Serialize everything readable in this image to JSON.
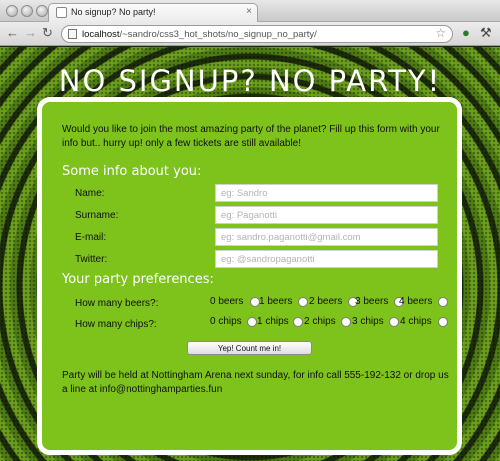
{
  "browser": {
    "tab_title": "No signup? No party!",
    "url_host": "localhost",
    "url_path": "/~sandro/css3_hot_shots/no_signup_no_party/"
  },
  "page": {
    "title": "NO SIGNUP? NO PARTY!",
    "intro": "Would you like to join the most amazing party of the planet? Fill up this form with your info but.. hurry up! only a few tickets are still available!",
    "section_info": "Some info about you:",
    "section_prefs": "Your party preferences:",
    "fields": [
      {
        "label": "Name:",
        "placeholder": "eg: Sandro",
        "value": ""
      },
      {
        "label": "Surname:",
        "placeholder": "eg: Paganotti",
        "value": ""
      },
      {
        "label": "E-mail:",
        "placeholder": "eg: sandro.paganotti@gmail.com",
        "value": ""
      },
      {
        "label": "Twitter:",
        "placeholder": "eg: @sandropaganotti",
        "value": ""
      }
    ],
    "beers": {
      "label": "How many beers?:",
      "options": [
        "0 beers",
        "1 beers",
        "2 beers",
        "3 beers",
        "4 beers"
      ]
    },
    "chips": {
      "label": "How many chips?:",
      "options": [
        "0 chips",
        "1 chips",
        "2 chips",
        "3 chips",
        "4 chips"
      ]
    },
    "submit_label": "Yep! Count me in!",
    "footer": "Party will be held at Nottingham Arena next sunday, for info call 555-192-132 or drop us a line at info@nottinghamparties.fun"
  },
  "icons": {
    "back": "back-arrow-icon",
    "forward": "forward-arrow-icon",
    "reload": "reload-icon",
    "bookmark": "star-icon",
    "extension": "extension-icon",
    "wrench": "wrench-icon"
  },
  "colors": {
    "card_background": "#7dc31b",
    "card_border": "#ffffff",
    "heading_text": "#ffffff"
  }
}
